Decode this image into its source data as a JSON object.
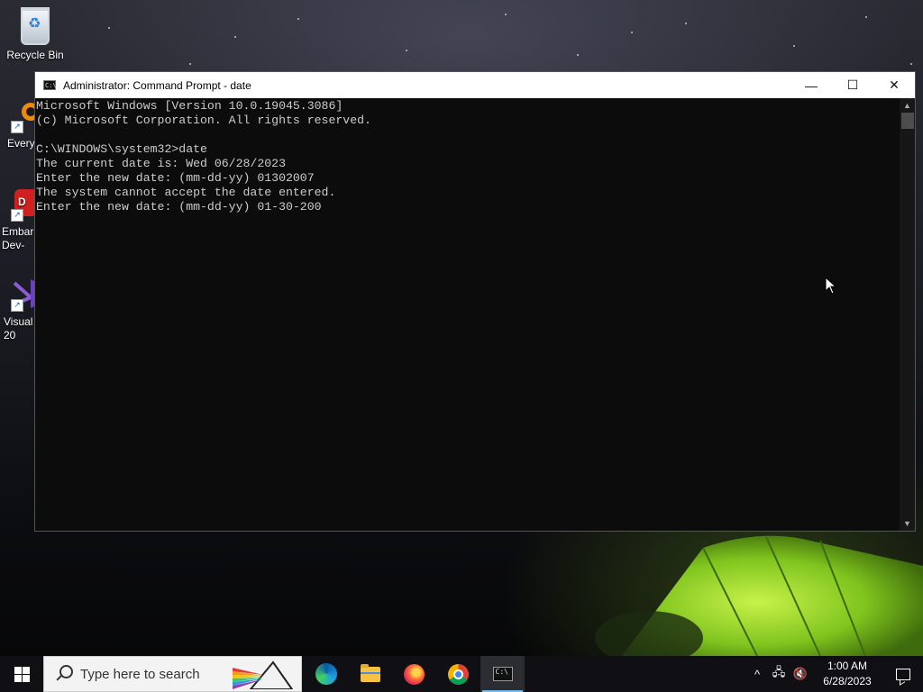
{
  "desktop": {
    "icons": [
      {
        "label": "Recycle Bin"
      },
      {
        "label": "Every"
      },
      {
        "label": "Embar\nDev-"
      },
      {
        "label": "Visual\n20"
      }
    ]
  },
  "window": {
    "title": "Administrator: Command Prompt - date",
    "minimize_glyph": "—",
    "maximize_glyph": "☐",
    "close_glyph": "✕",
    "icon_glyph": "C:\\",
    "console_lines": [
      "Microsoft Windows [Version 10.0.19045.3086]",
      "(c) Microsoft Corporation. All rights reserved.",
      "",
      "C:\\WINDOWS\\system32>date",
      "The current date is: Wed 06/28/2023",
      "Enter the new date: (mm-dd-yy) 01302007",
      "The system cannot accept the date entered.",
      "Enter the new date: (mm-dd-yy) 01-30-200"
    ],
    "scroll_up_glyph": "▲",
    "scroll_down_glyph": "▼",
    "colors": {
      "console_bg": "#0c0c0c",
      "console_text": "#cccccc",
      "titlebar_bg": "#ffffff"
    }
  },
  "taskbar": {
    "search_placeholder": "Type here to search",
    "apps": [
      {
        "name": "edge-icon"
      },
      {
        "name": "file-explorer-icon"
      },
      {
        "name": "firefox-icon"
      },
      {
        "name": "chrome-icon"
      },
      {
        "name": "command-prompt-icon",
        "active": true
      }
    ],
    "tray": {
      "chevron": "^",
      "network_glyph": "🖧",
      "volume_glyph": "🔇",
      "time": "1:00 AM",
      "date": "6/28/2023"
    },
    "colors": {
      "bg": "#0f0f14",
      "active_underline": "#76b9ed"
    }
  }
}
